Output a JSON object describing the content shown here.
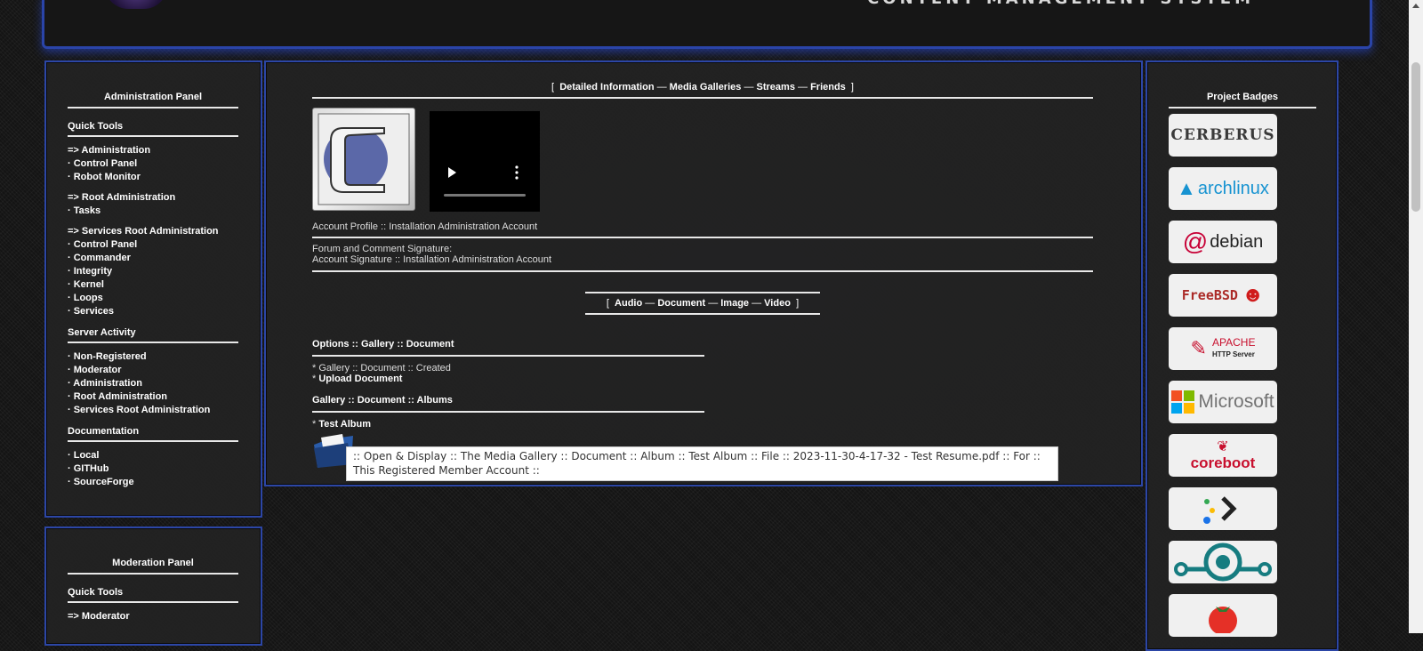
{
  "header": {
    "tagline": "CONTENT MANAGEMENT SYSTEM"
  },
  "admin_panel": {
    "title": "Administration Panel",
    "quick_tools_head": "Quick Tools",
    "group1": {
      "head": "=> Administration",
      "items": [
        "· Control Panel",
        "· Robot Monitor"
      ]
    },
    "group2": {
      "head": "=> Root Administration",
      "items": [
        "· Tasks"
      ]
    },
    "group3": {
      "head": "=> Services Root Administration",
      "items": [
        "· Control Panel",
        "· Commander",
        "· Integrity",
        "· Kernel",
        "· Loops",
        "· Services"
      ]
    },
    "server_activity_head": "Server Activity",
    "server_activity": [
      "· Non-Registered",
      "· Moderator",
      "· Administration",
      "· Root Administration",
      "· Services Root Administration"
    ],
    "documentation_head": "Documentation",
    "documentation": [
      "· Local",
      "· GITHub",
      "· SourceForge"
    ]
  },
  "mod_panel": {
    "title": "Moderation Panel",
    "quick_tools_head": "Quick Tools",
    "first": "=> Moderator"
  },
  "badges_panel": {
    "title": "Project Badges",
    "badges": [
      {
        "label": "CERBERUS",
        "icon": "cerberus-logo"
      },
      {
        "label": "archlinux",
        "icon": "arch-logo"
      },
      {
        "label": "debian",
        "icon": "debian-swirl"
      },
      {
        "label": "FreeBSD",
        "icon": "bsd-daemon"
      },
      {
        "label": "APACHE",
        "sub": "HTTP Server",
        "icon": "apache-feather"
      },
      {
        "label": "Microsoft",
        "icon": "microsoft-squares"
      },
      {
        "label": "coreboot",
        "icon": "coreboot-rabbit"
      },
      {
        "label": "",
        "icon": "prompt-logo"
      },
      {
        "label": "",
        "icon": "lineage-logo"
      },
      {
        "label": "",
        "icon": "tomato-logo"
      }
    ],
    "colors": {
      "ms_red": "#f25022",
      "ms_green": "#7fba00",
      "ms_blue": "#00a4ef",
      "ms_yellow": "#ffb900"
    }
  },
  "main": {
    "tabs_open": "[",
    "tabs": [
      "Detailed Information",
      "Media Galleries",
      "Streams",
      "Friends"
    ],
    "tabs_sep": "—",
    "tabs_close": "]",
    "profile": "Account Profile :: Installation Administration Account",
    "sig_label": "Forum and Comment Signature:",
    "sig_value": "Account Signature :: Installation Administration Account",
    "type_tabs": [
      "Audio",
      "Document",
      "Image",
      "Video"
    ],
    "options_head": "Options :: Gallery :: Document",
    "created": "* Gallery :: Document :: Created",
    "upload_prefix": "* ",
    "upload": "Upload Document",
    "albums_head": "Gallery :: Document :: Albums",
    "album_prefix": "* ",
    "album": "Test Album",
    "tooltip": ":: Open & Display :: The Media Gallery :: Document :: Album :: Test Album :: File :: 2023-11-30-4-17-32 - Test Resume.pdf :: For :: This Registered Member Account ::"
  }
}
